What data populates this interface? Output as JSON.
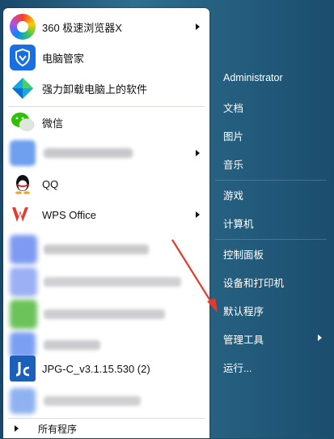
{
  "programs": [
    {
      "label": "360 极速浏览器X",
      "icon": "360-browser-icon",
      "has_submenu": true
    },
    {
      "label": "电脑管家",
      "icon": "pc-manager-shield-icon",
      "has_submenu": false
    },
    {
      "label": "强力卸载电脑上的软件",
      "icon": "uninstall-icon",
      "has_submenu": false
    },
    {
      "label": "微信",
      "icon": "wechat-icon",
      "has_submenu": false
    },
    {
      "label": "",
      "icon": "blurred-app-icon",
      "has_submenu": true
    },
    {
      "label": "QQ",
      "icon": "qq-penguin-icon",
      "has_submenu": false
    },
    {
      "label": "WPS Office",
      "icon": "wps-office-icon",
      "has_submenu": true
    },
    {
      "label": "",
      "icon": "blurred-app-icon",
      "has_submenu": false
    },
    {
      "label": "",
      "icon": "blurred-app-icon",
      "has_submenu": false
    },
    {
      "label": "",
      "icon": "blurred-app-icon",
      "has_submenu": false
    },
    {
      "label": "",
      "icon": "blurred-app-icon",
      "has_submenu": false
    },
    {
      "label": "JPG-C_v3.1.15.530 (2)",
      "icon": "jpg-c-icon",
      "has_submenu": false
    },
    {
      "label": "",
      "icon": "blurred-app-icon",
      "has_submenu": false
    }
  ],
  "all_programs": "所有程序",
  "right_links": {
    "user": "Administrator",
    "documents": "文档",
    "pictures": "图片",
    "music": "音乐",
    "games": "游戏",
    "computer": "计算机",
    "control_panel": "控制面板",
    "devices": "设备和打印机",
    "default_programs": "默认程序",
    "admin_tools": "管理工具",
    "run": "运行..."
  },
  "colors": {
    "panel_bg": "#1e4f6b",
    "arrow_annotation": "#e23b2e"
  }
}
